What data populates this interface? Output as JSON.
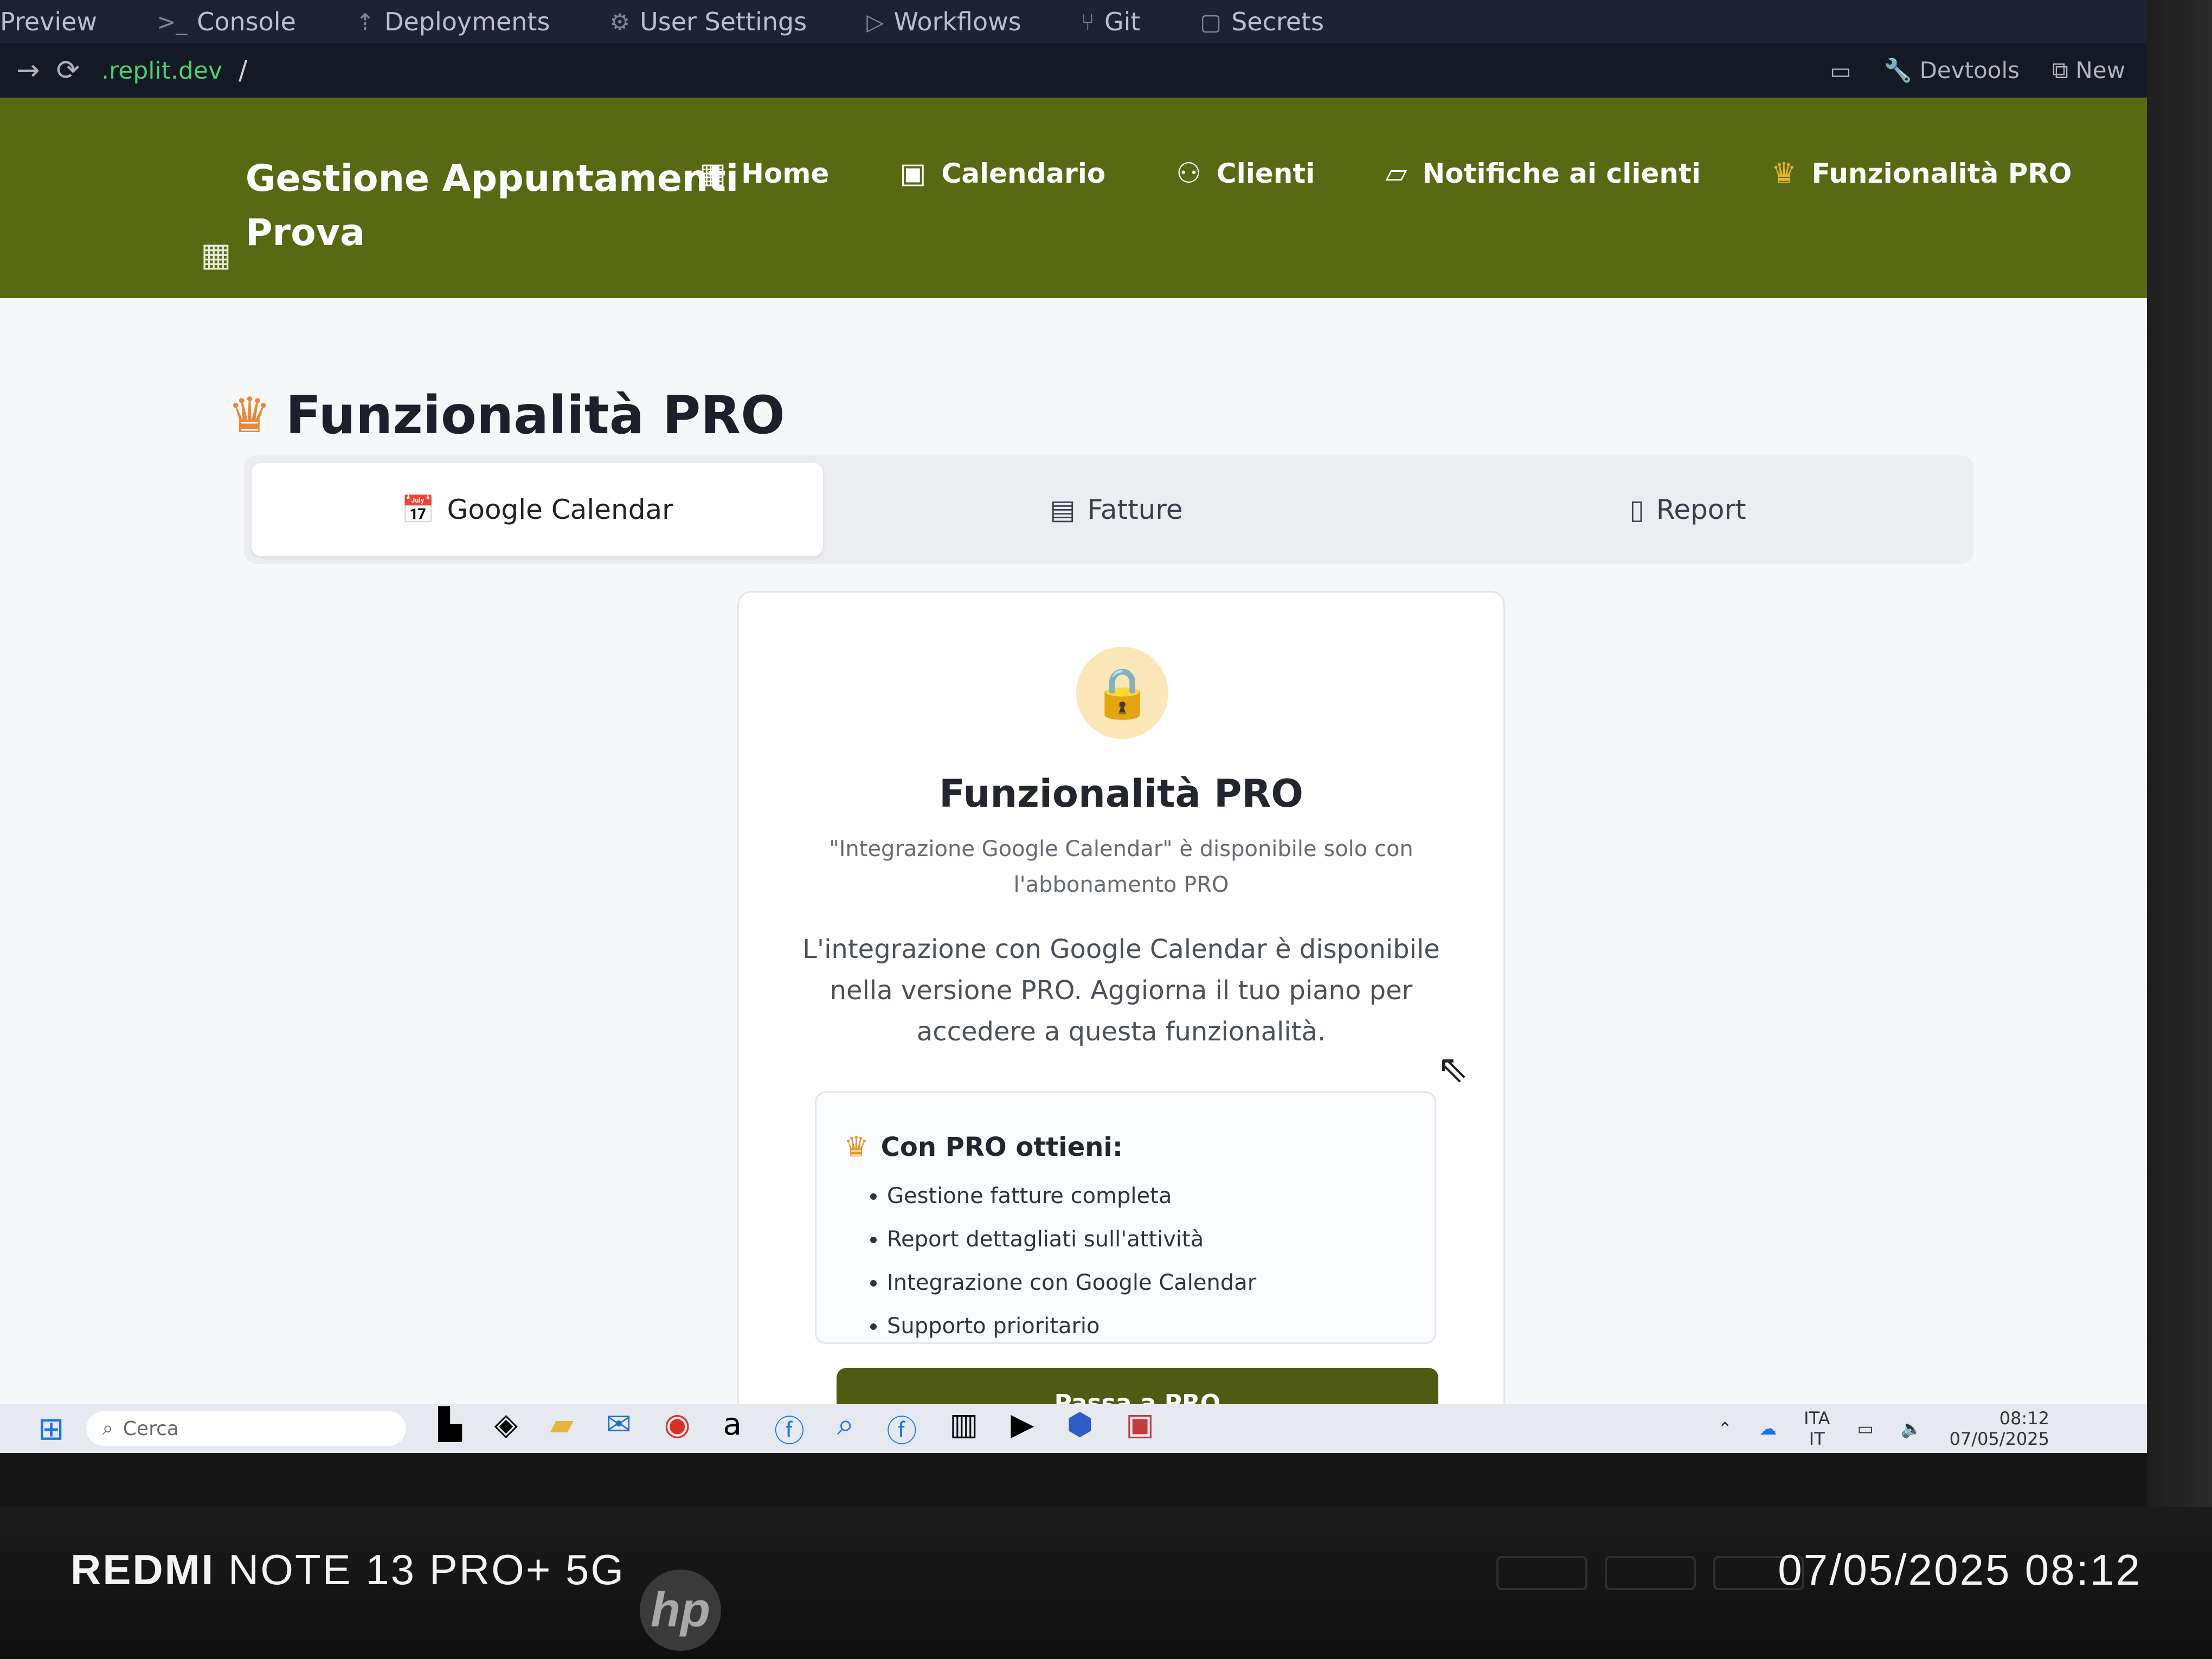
{
  "browser": {
    "tabs": [
      {
        "label": "Preview",
        "icon": "preview-icon"
      },
      {
        "label": "Console",
        "icon": "terminal-icon"
      },
      {
        "label": "Deployments",
        "icon": "rocket-icon"
      },
      {
        "label": "User Settings",
        "icon": "gear-icon"
      },
      {
        "label": "Workflows",
        "icon": "play-icon"
      },
      {
        "label": "Git",
        "icon": "git-icon"
      },
      {
        "label": "Secrets",
        "icon": "lock-icon"
      }
    ],
    "url_host": ".replit.dev",
    "url_path": "/",
    "devtools_label": "Devtools",
    "new_tab_label": "New"
  },
  "app": {
    "brand_line1": "Gestione Appuntamenti",
    "brand_line2": "Prova",
    "nav": [
      {
        "label": "Home",
        "icon": "grid-icon"
      },
      {
        "label": "Calendario",
        "icon": "calendar-icon"
      },
      {
        "label": "Clienti",
        "icon": "users-icon"
      },
      {
        "label": "Notifiche ai clienti",
        "icon": "message-icon"
      },
      {
        "label": "Funzionalità PRO",
        "icon": "crown-icon"
      }
    ]
  },
  "main": {
    "title": "Funzionalità PRO",
    "tabs": [
      {
        "label": "Google Calendar",
        "icon": "calendar-icon",
        "active": true
      },
      {
        "label": "Fatture",
        "icon": "receipt-icon",
        "active": false
      },
      {
        "label": "Report",
        "icon": "file-icon",
        "active": false
      }
    ],
    "card": {
      "title": "Funzionalità PRO",
      "subtitle": "\"Integrazione Google Calendar\" è disponibile solo con l'abbonamento PRO",
      "description": "L'integrazione con Google Calendar è disponibile nella versione PRO. Aggiorna il tuo piano per accedere a questa funzionalità.",
      "benefits_title": "Con PRO ottieni:",
      "benefits": [
        "Gestione fatture completa",
        "Report dettagliati sull'attività",
        "Integrazione con Google Calendar",
        "Supporto prioritario"
      ],
      "button_label": "Passa a PRO"
    }
  },
  "taskbar": {
    "search_placeholder": "Cerca",
    "lang_line1": "ITA",
    "lang_line2": "IT",
    "time": "08:12",
    "date": "07/05/2025"
  },
  "photo": {
    "device_brand": "REDMI",
    "device_model": "NOTE 13 PRO+ 5G",
    "timestamp": "07/05/2025 08:12",
    "monitor_logo": "hp"
  },
  "colors": {
    "header_bg": "#576913",
    "accent_crown": "#e8893a",
    "lock_bg": "#fbe7b8",
    "button_bg": "#4f5a12"
  }
}
